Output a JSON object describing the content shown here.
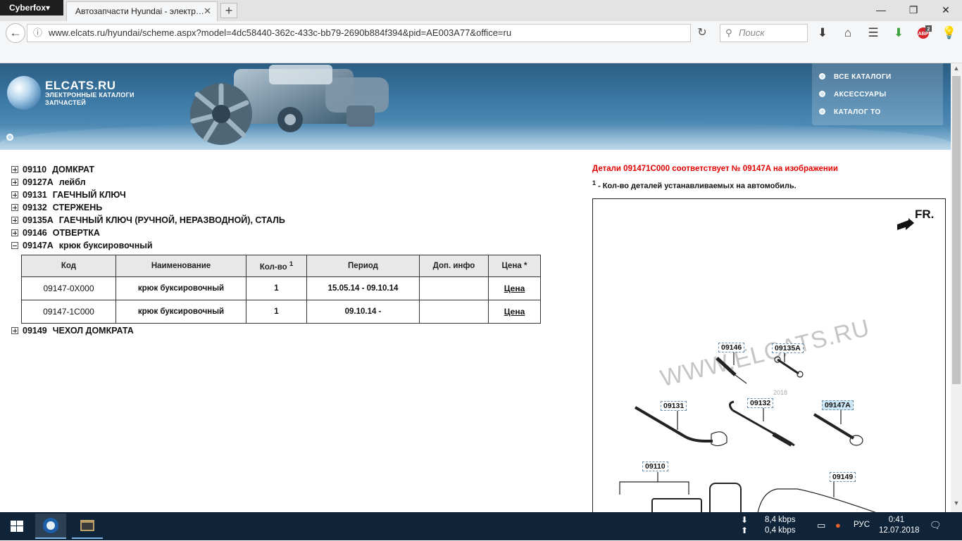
{
  "browser": {
    "app_menu_label": "Cyberfox▾",
    "tab_title": "Автозапчасти Hyundai - электр…",
    "tab_close": "✕",
    "new_tab": "+",
    "url": "www.elcats.ru/hyundai/scheme.aspx?model=4dc58440-362c-433c-bb79-2690b884f394&pid=AE003A77&office=ru",
    "search_placeholder": "Поиск",
    "badge_count": "2",
    "addon_label": "ABP"
  },
  "banner": {
    "logo_title": "ELCATS.RU",
    "logo_sub1": "ЭЛЕКТРОННЫЕ КАТАЛОГИ",
    "logo_sub2": "ЗАПЧАСТЕЙ",
    "menu": [
      "ВСЕ КАТАЛОГИ",
      "АКСЕССУАРЫ",
      "КАТАЛОГ ТО"
    ]
  },
  "tree": [
    {
      "code": "09110",
      "name": "ДОМКРАТ",
      "expanded": false
    },
    {
      "code": "09127A",
      "name": "лейбл",
      "expanded": false
    },
    {
      "code": "09131",
      "name": "ГАЕЧНЫЙ КЛЮЧ",
      "expanded": false
    },
    {
      "code": "09132",
      "name": "СТЕРЖЕНЬ",
      "expanded": false
    },
    {
      "code": "09135A",
      "name": "ГАЕЧНЫЙ КЛЮЧ (РУЧНОЙ, НЕРАЗВОДНОЙ), СТАЛЬ",
      "expanded": false
    },
    {
      "code": "09146",
      "name": "ОТВЕРТКА",
      "expanded": false
    },
    {
      "code": "09147A",
      "name": "крюк буксировочный",
      "expanded": true
    },
    {
      "code": "09149",
      "name": "ЧЕХОЛ ДОМКРАТА",
      "expanded": false
    }
  ],
  "table": {
    "headers": {
      "code": "Код",
      "name": "Наименование",
      "qty": "Кол-во",
      "qty_sup": "1",
      "period": "Период",
      "info": "Доп. инфо",
      "price": "Цена *"
    },
    "rows": [
      {
        "code": "09147-0X000",
        "name": "крюк буксировочный",
        "qty": "1",
        "period": "15.05.14 - 09.10.14",
        "info": "",
        "price": "Цена"
      },
      {
        "code": "09147-1C000",
        "name": "крюк буксировочный",
        "qty": "1",
        "period": "09.10.14 -",
        "info": "",
        "price": "Цена"
      }
    ]
  },
  "right": {
    "notice": "Детали 091471C000 соответствует № 09147A на изображении",
    "qty_sup": "1",
    "qty_text": " - Кол-во деталей устанавливаемых на автомобиль."
  },
  "diagram": {
    "fr_label": "FR.",
    "watermark": "WWW.ELCATS.RU",
    "watermark_year": "2018",
    "labels": {
      "p09146": "09146",
      "p09135a": "09135A",
      "p09131": "09131",
      "p09132": "09132",
      "p09147a": "09147A",
      "p09110": "09110",
      "p09149": "09149"
    }
  },
  "taskbar": {
    "speed_down": "8,4 kbps",
    "speed_up": "0,4 kbps",
    "lang": "РУС",
    "time": "0:41",
    "date": "12.07.2018"
  },
  "colors": {
    "notice_red": "#e00000",
    "banner_blue": "#3d7aa6",
    "taskbar": "#0f2439"
  }
}
